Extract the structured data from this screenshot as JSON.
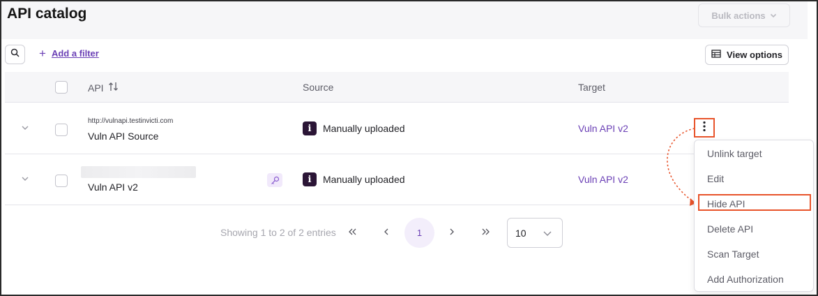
{
  "page": {
    "title": "API catalog"
  },
  "toolbar": {
    "bulk_actions_label": "Bulk actions",
    "add_filter_label": "Add a filter",
    "view_options_label": "View options"
  },
  "table": {
    "columns": [
      "API",
      "Source",
      "Target"
    ],
    "rows": [
      {
        "url": "http://vulnapi.testinvicti.com",
        "name": "Vuln API Source",
        "source": "Manually uploaded",
        "target": "Vuln API v2"
      },
      {
        "url": "",
        "name": "Vuln API v2",
        "source": "Manually uploaded",
        "target": "Vuln API v2"
      }
    ]
  },
  "pagination": {
    "summary": "Showing 1 to 2 of 2 entries",
    "current_page": "1",
    "per_page": "10"
  },
  "context_menu": {
    "items": [
      "Unlink target",
      "Edit",
      "Hide API",
      "Delete API",
      "Scan Target",
      "Add Authorization"
    ],
    "highlighted": "Hide API"
  },
  "colors": {
    "accent": "#6a3fb5",
    "highlight": "#e8532a",
    "source_icon_bg": "#2b1536"
  },
  "icons": {
    "search": "search-icon",
    "sort": "sort-icon",
    "view_options": "table-icon",
    "kebab": "more-vertical-icon",
    "key": "key-icon",
    "source": "info-icon"
  }
}
